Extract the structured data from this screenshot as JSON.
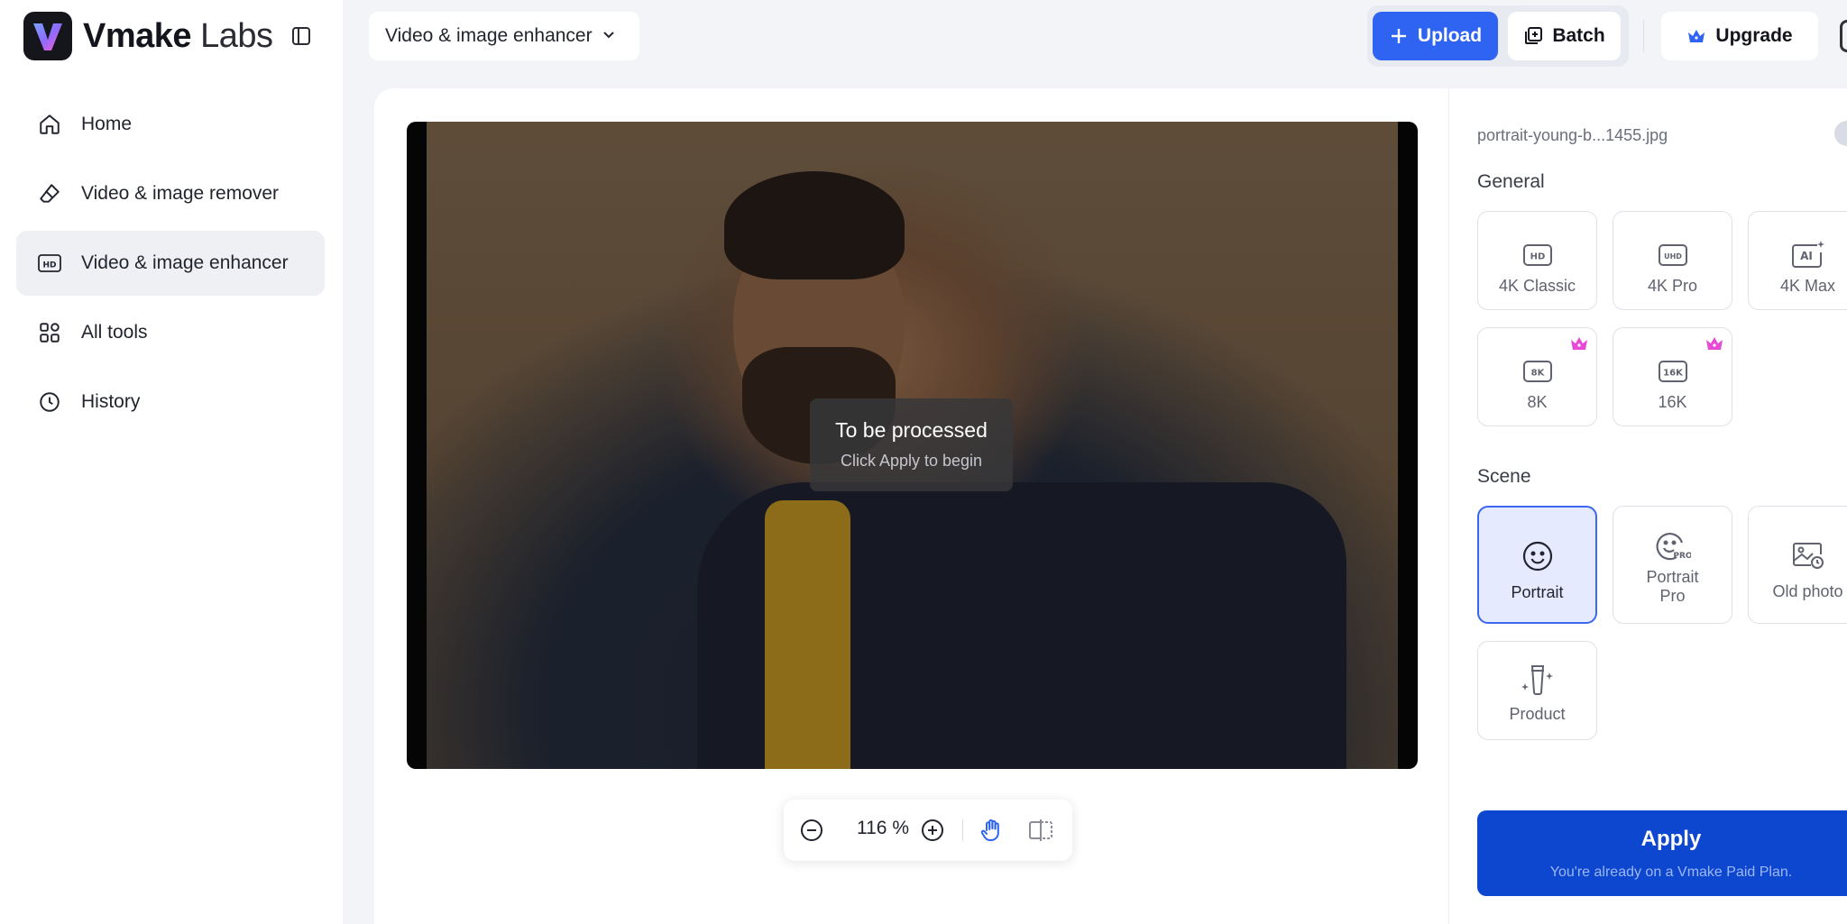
{
  "app": {
    "brand_bold": "Vmake",
    "brand_light": "Labs"
  },
  "sidebar": {
    "items": [
      {
        "label": "Home",
        "icon": "home-icon"
      },
      {
        "label": "Video & image remover",
        "icon": "eraser-icon"
      },
      {
        "label": "Video & image enhancer",
        "icon": "hd-icon",
        "active": true
      },
      {
        "label": "All tools",
        "icon": "grid-icon"
      },
      {
        "label": "History",
        "icon": "clock-icon"
      }
    ]
  },
  "topbar": {
    "tool_select": "Video & image enhancer",
    "upload_label": "Upload",
    "batch_label": "Batch",
    "upgrade_label": "Upgrade"
  },
  "preview": {
    "status_title": "To be processed",
    "status_sub": "Click Apply to begin"
  },
  "zoom": {
    "value": "116 %"
  },
  "panel": {
    "file_name": "portrait-young-b...1455.jpg",
    "general_title": "General",
    "general_options": [
      {
        "label": "4K Classic",
        "icon": "hd-badge-icon"
      },
      {
        "label": "4K Pro",
        "icon": "uhd-badge-icon"
      },
      {
        "label": "4K Max",
        "icon": "ai-ultra-icon"
      },
      {
        "label": "8K",
        "icon": "8k-badge-icon",
        "premium": true
      },
      {
        "label": "16K",
        "icon": "16k-badge-icon",
        "premium": true
      }
    ],
    "scene_title": "Scene",
    "scene_options": [
      {
        "label": "Portrait",
        "icon": "smile-icon",
        "selected": true
      },
      {
        "label": "Portrait Pro",
        "icon": "smile-pro-icon"
      },
      {
        "label": "Old photo",
        "icon": "old-photo-icon"
      },
      {
        "label": "Product",
        "icon": "product-icon"
      }
    ],
    "apply_label": "Apply",
    "apply_note": "You're already on a Vmake Paid Plan."
  },
  "colors": {
    "accent": "#2f64f2",
    "apply": "#0d47cf",
    "premium": "#e64bd8",
    "selected_bg": "#e5eaff"
  }
}
